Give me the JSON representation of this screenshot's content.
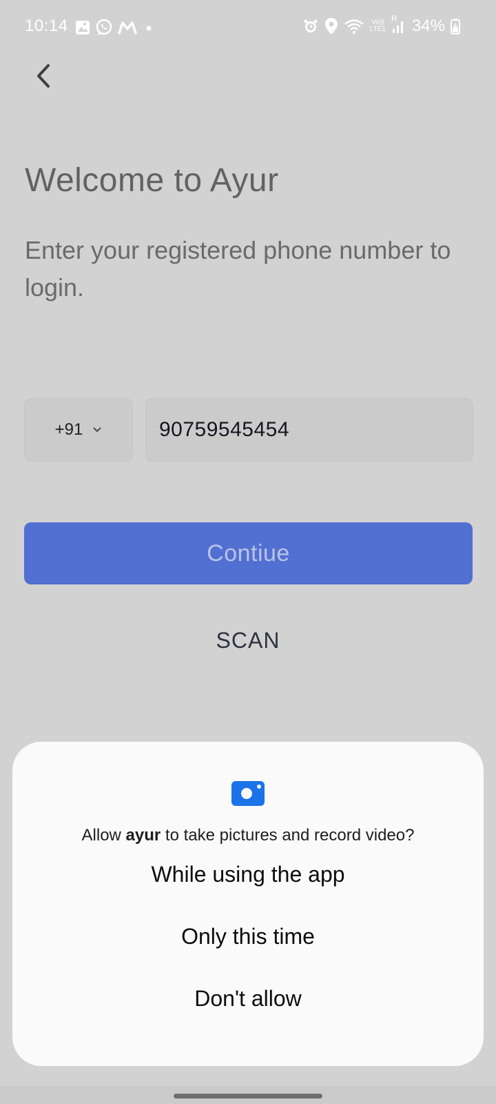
{
  "status_bar": {
    "time": "10:14",
    "battery": "34%",
    "network_top": "Vo))",
    "network_bottom": "LTE1",
    "roaming": "R"
  },
  "header": {
    "title": "Welcome to Ayur",
    "subtitle": "Enter your registered phone number to login."
  },
  "form": {
    "country_code": "+91",
    "phone_value": "90759545454",
    "continue_label": "Contiue",
    "scan_label": "SCAN"
  },
  "dialog": {
    "prompt_before": "Allow ",
    "app_name": "ayur",
    "prompt_after": " to take pictures and record video?",
    "options": [
      "While using the app",
      "Only this time",
      "Don't allow"
    ]
  },
  "colors": {
    "background": "#d2d2d2",
    "accent": "#5270d2",
    "camera_icon": "#1a73e8"
  }
}
